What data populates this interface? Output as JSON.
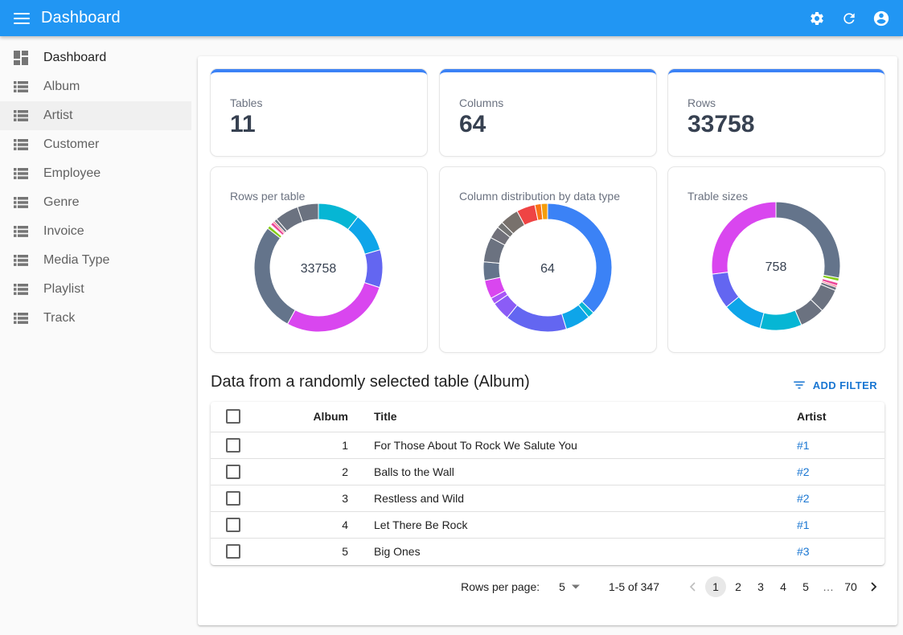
{
  "appbar": {
    "title": "Dashboard",
    "icons": [
      "menu-icon",
      "settings-icon",
      "refresh-icon",
      "account-circle-icon"
    ]
  },
  "sidebar": {
    "items": [
      {
        "label": "Dashboard",
        "icon": "dashboard-icon",
        "active": true
      },
      {
        "label": "Album",
        "icon": "list-icon"
      },
      {
        "label": "Artist",
        "icon": "list-icon",
        "hover": true
      },
      {
        "label": "Customer",
        "icon": "list-icon"
      },
      {
        "label": "Employee",
        "icon": "list-icon"
      },
      {
        "label": "Genre",
        "icon": "list-icon"
      },
      {
        "label": "Invoice",
        "icon": "list-icon"
      },
      {
        "label": "Media Type",
        "icon": "list-icon"
      },
      {
        "label": "Playlist",
        "icon": "list-icon"
      },
      {
        "label": "Track",
        "icon": "list-icon"
      }
    ]
  },
  "stats": [
    {
      "label": "Tables",
      "value": "11"
    },
    {
      "label": "Columns",
      "value": "64"
    },
    {
      "label": "Rows",
      "value": "33758"
    }
  ],
  "colors": {
    "appbar": "#2196f3",
    "accent": "#3b82f6",
    "link": "#1976d2"
  },
  "chart_data": [
    {
      "type": "pie",
      "title": "Rows per table",
      "center_label": "33758",
      "start": "top",
      "slices": [
        {
          "value": 0.105,
          "color": "#06b6d4"
        },
        {
          "value": 0.1,
          "color": "#0ea5e9"
        },
        {
          "value": 0.095,
          "color": "#6366f1"
        },
        {
          "value": 0.28,
          "color": "#d946ef"
        },
        {
          "value": 0.275,
          "color": "#64748b"
        },
        {
          "value": 0.008,
          "color": "#84cc16"
        },
        {
          "value": 0.004,
          "color": "#ffffff"
        },
        {
          "value": 0.008,
          "color": "#ec4899"
        },
        {
          "value": 0.004,
          "color": "#f43f5e"
        },
        {
          "value": 0.008,
          "color": "#6b7280"
        },
        {
          "value": 0.06,
          "color": "#6b7280"
        },
        {
          "value": 0.053,
          "color": "#6b7280"
        }
      ]
    },
    {
      "type": "pie",
      "title": "Column distribution by data type",
      "center_label": "64",
      "start": "top",
      "slices": [
        {
          "value": 0.375,
          "color": "#3b82f6"
        },
        {
          "value": 0.016,
          "color": "#06b6d4"
        },
        {
          "value": 0.063,
          "color": "#0ea5e9"
        },
        {
          "value": 0.156,
          "color": "#6366f1"
        },
        {
          "value": 0.047,
          "color": "#8b5cf6"
        },
        {
          "value": 0.016,
          "color": "#a855f7"
        },
        {
          "value": 0.047,
          "color": "#d946ef"
        },
        {
          "value": 0.047,
          "color": "#64748b"
        },
        {
          "value": 0.063,
          "color": "#6b7280"
        },
        {
          "value": 0.031,
          "color": "#71717a"
        },
        {
          "value": 0.016,
          "color": "#737373"
        },
        {
          "value": 0.047,
          "color": "#78716c"
        },
        {
          "value": 0.047,
          "color": "#ef4444"
        },
        {
          "value": 0.016,
          "color": "#f97316"
        },
        {
          "value": 0.016,
          "color": "#f59e0b"
        }
      ]
    },
    {
      "type": "pie",
      "title": "Trable sizes",
      "center_label": "758",
      "start": "top",
      "slices": [
        {
          "value": 0.28,
          "color": "#64748b"
        },
        {
          "value": 0.008,
          "color": "#84cc16"
        },
        {
          "value": 0.004,
          "color": "#ffffff"
        },
        {
          "value": 0.008,
          "color": "#ec4899"
        },
        {
          "value": 0.004,
          "color": "#f43f5e"
        },
        {
          "value": 0.008,
          "color": "#6b7280"
        },
        {
          "value": 0.06,
          "color": "#6b7280"
        },
        {
          "value": 0.063,
          "color": "#6b7280"
        },
        {
          "value": 0.105,
          "color": "#06b6d4"
        },
        {
          "value": 0.1,
          "color": "#0ea5e9"
        },
        {
          "value": 0.09,
          "color": "#6366f1"
        },
        {
          "value": 0.27,
          "color": "#d946ef"
        }
      ]
    }
  ],
  "table_section": {
    "title": "Data from a randomly selected table (Album)",
    "add_filter_label": "ADD FILTER",
    "columns": [
      "Album",
      "Title",
      "Artist"
    ],
    "rows": [
      {
        "album": "1",
        "title": "For Those About To Rock We Salute You",
        "artist": "#1"
      },
      {
        "album": "2",
        "title": "Balls to the Wall",
        "artist": "#2"
      },
      {
        "album": "3",
        "title": "Restless and Wild",
        "artist": "#2"
      },
      {
        "album": "4",
        "title": "Let There Be Rock",
        "artist": "#1"
      },
      {
        "album": "5",
        "title": "Big Ones",
        "artist": "#3"
      }
    ]
  },
  "pagination": {
    "rows_per_page_label": "Rows per page:",
    "rows_per_page": "5",
    "range": "1-5 of 347",
    "pages": [
      "1",
      "2",
      "3",
      "4",
      "5",
      "…",
      "70"
    ],
    "current_page": "1"
  }
}
